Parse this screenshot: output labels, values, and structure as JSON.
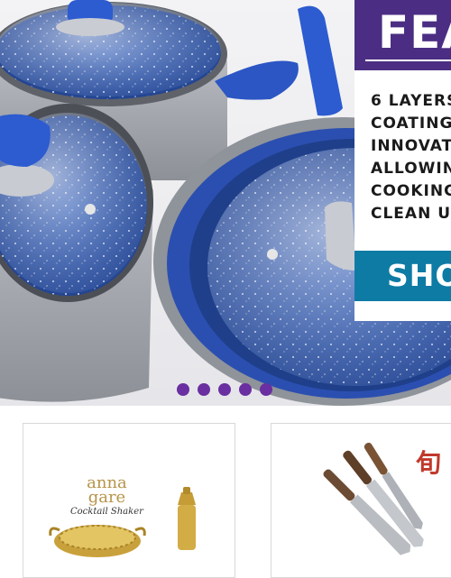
{
  "hero": {
    "feature_title": "FEA",
    "feature_lines": [
      "6 LAYERS",
      "COATING,",
      "INNOVATIC",
      "ALLOWING",
      "COOKING",
      "CLEAN UP"
    ],
    "shop_label": "SHO",
    "slide_count": 5,
    "colors": {
      "title_bar": "#4b2e83",
      "shop_button": "#0e7ba5",
      "dot": "#6a2fa0"
    }
  },
  "products": [
    {
      "brand_line1": "anna",
      "brand_line2": "gare",
      "brand_caption": "Cocktail Shaker"
    },
    {
      "brand_mark": "旬"
    }
  ]
}
